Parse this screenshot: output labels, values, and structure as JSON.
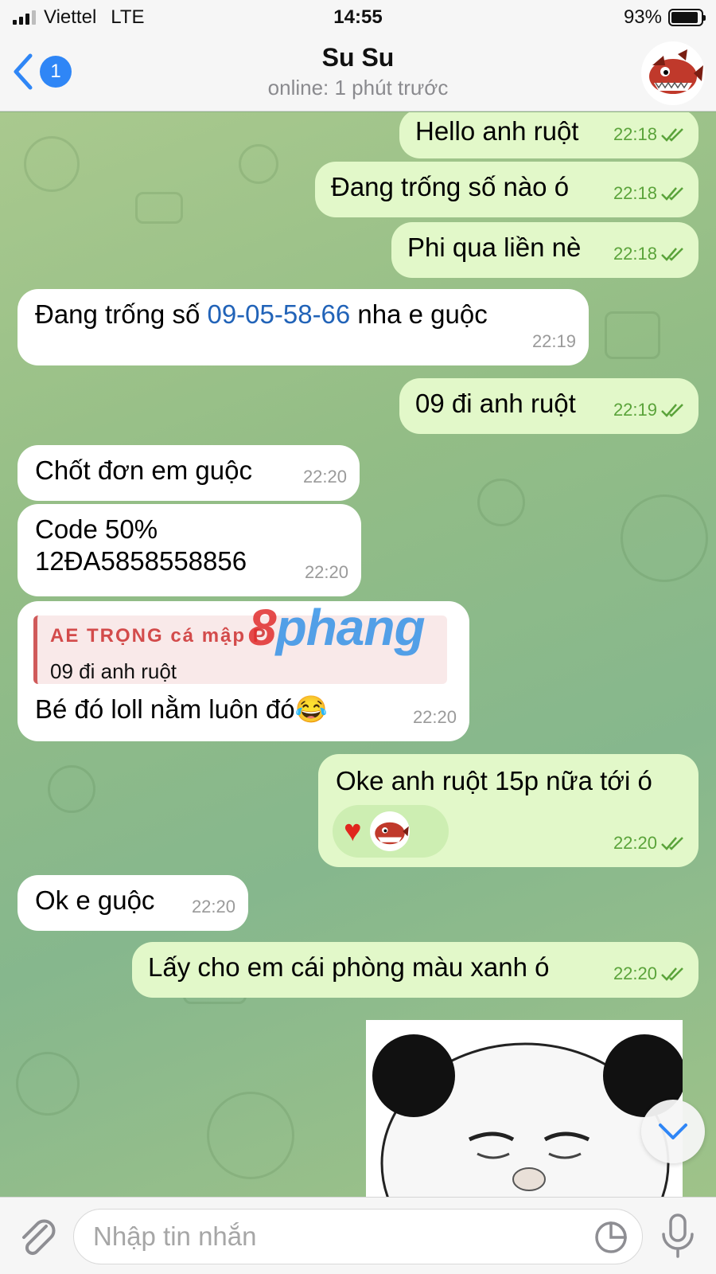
{
  "status_bar": {
    "carrier": "Viettel",
    "network": "LTE",
    "time": "14:55",
    "battery_percent": "93%",
    "battery_level": 0.93
  },
  "header": {
    "back_badge": "1",
    "title": "Su Su",
    "subtitle": "online: 1 phút trước",
    "avatar_icon": "piranha-avatar"
  },
  "messages": [
    {
      "dir": "out",
      "text": "Hello anh ruột",
      "time": "22:18"
    },
    {
      "dir": "out",
      "text": "Đang trống số nào ó",
      "time": "22:18"
    },
    {
      "dir": "out",
      "text": "Phi qua liền nè",
      "time": "22:18"
    },
    {
      "dir": "in",
      "text_before": "Đang trống số ",
      "link": "09-05-58-66",
      "text_after": " nha e guộc",
      "time": "22:19"
    },
    {
      "dir": "out",
      "text": "09 đi anh ruột",
      "time": "22:19"
    },
    {
      "dir": "in",
      "text": "Chốt đơn em guộc",
      "time": "22:20"
    },
    {
      "dir": "in",
      "line1": "Code 50%",
      "line2": "12ĐA5858558856",
      "time": "22:20"
    },
    {
      "dir": "in",
      "quote_name": "AE TRỌNG cá mập P",
      "quote_text": "09 đi anh ruột",
      "text": "Bé đó loll nằm luôn đó😂",
      "time": "22:20"
    },
    {
      "dir": "out",
      "text": "Oke anh ruột 15p nữa tới ó",
      "reaction": "♥",
      "time": "22:20"
    },
    {
      "dir": "in",
      "text": "Ok e guộc",
      "time": "22:20"
    },
    {
      "dir": "out",
      "text": "Lấy cho em cái phòng màu xanh ó",
      "time": "22:20"
    }
  ],
  "watermark": {
    "part1": "8",
    "part2": "phang"
  },
  "input": {
    "placeholder": "Nhập tin nhắn",
    "value": ""
  },
  "colors": {
    "outgoing_bubble": "#e2f8c9",
    "incoming_bubble": "#ffffff",
    "accent": "#2f86f6",
    "check_green": "#5aa33a",
    "link_blue": "#2163b8"
  },
  "icons": [
    "back-chevron-icon",
    "paperclip-icon",
    "sticker-icon",
    "microphone-icon",
    "chevron-down-icon",
    "double-check-icon"
  ]
}
